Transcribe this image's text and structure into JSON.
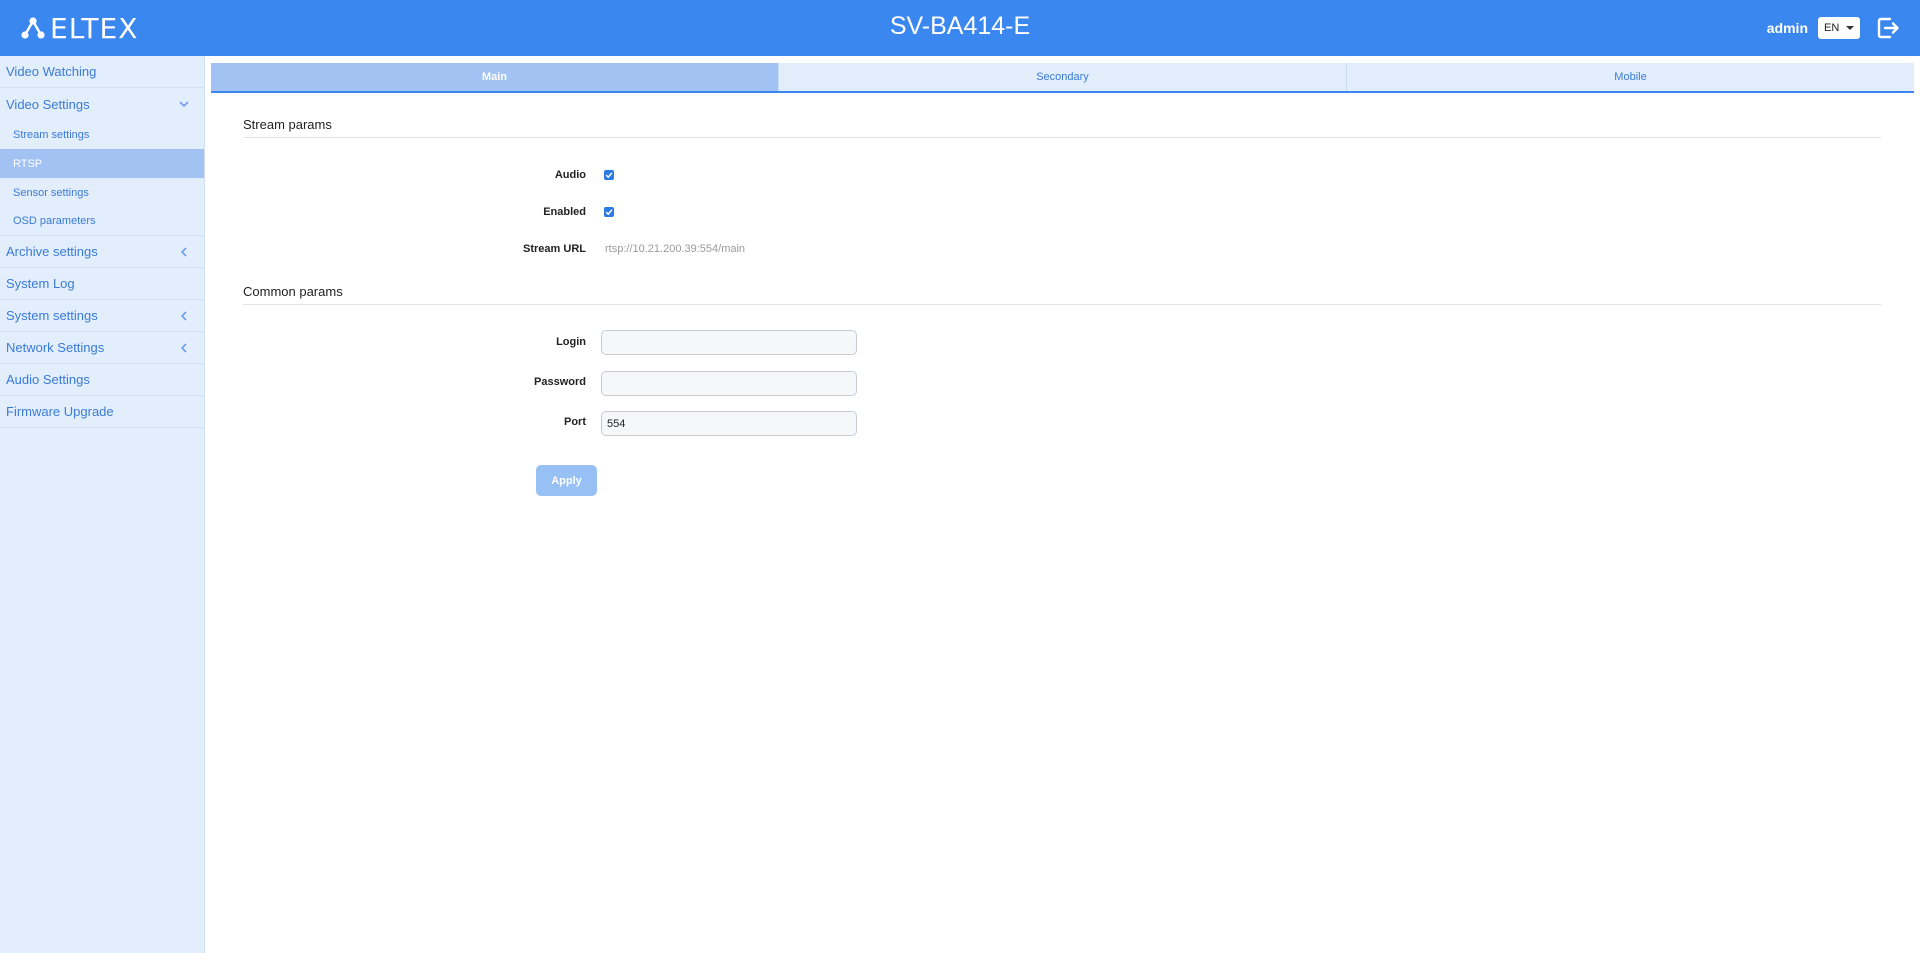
{
  "header": {
    "logo_text": "ELTEX",
    "device_title": "SV-BA414-E",
    "username": "admin",
    "language": "EN",
    "accent_color": "#3a87f0"
  },
  "sidebar": {
    "items": [
      {
        "label": "Video Watching"
      },
      {
        "label": "Video Settings",
        "chevron": "down"
      },
      {
        "label": "Stream settings",
        "sub": true
      },
      {
        "label": "RTSP",
        "sub": true,
        "active": true
      },
      {
        "label": "Sensor settings",
        "sub": true
      },
      {
        "label": "OSD parameters",
        "sub": true
      },
      {
        "label": "Archive settings",
        "chevron": "left"
      },
      {
        "label": "System Log"
      },
      {
        "label": "System settings",
        "chevron": "left"
      },
      {
        "label": "Network Settings",
        "chevron": "left"
      },
      {
        "label": "Audio Settings"
      },
      {
        "label": "Firmware Upgrade"
      }
    ]
  },
  "tabs": [
    {
      "label": "Main",
      "active": true
    },
    {
      "label": "Secondary"
    },
    {
      "label": "Mobile"
    }
  ],
  "stream_params": {
    "title": "Stream params",
    "audio_label": "Audio",
    "audio_checked": true,
    "enabled_label": "Enabled",
    "enabled_checked": true,
    "url_label": "Stream URL",
    "url_value": "rtsp://10.21.200.39:554/main"
  },
  "common_params": {
    "title": "Common params",
    "login_label": "Login",
    "login_value": "",
    "password_label": "Password",
    "password_value": "",
    "port_label": "Port",
    "port_value": "554"
  },
  "apply_label": "Apply"
}
